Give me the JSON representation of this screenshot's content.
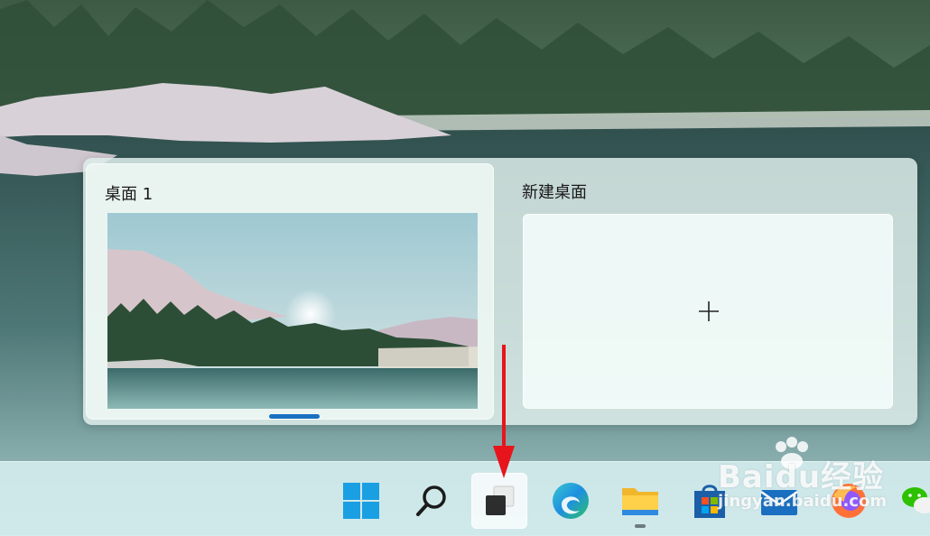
{
  "task_view": {
    "desktops": [
      {
        "label": "桌面 1",
        "active": true
      }
    ],
    "new_desktop": {
      "label": "新建桌面",
      "icon": "plus-icon"
    }
  },
  "taskbar": {
    "items": [
      {
        "name": "start",
        "icon": "windows-logo-icon"
      },
      {
        "name": "search",
        "icon": "search-icon"
      },
      {
        "name": "task-view",
        "icon": "task-view-icon",
        "hovered": true
      },
      {
        "name": "edge",
        "icon": "edge-browser-icon"
      },
      {
        "name": "file-explorer",
        "icon": "folder-icon",
        "running": true
      },
      {
        "name": "store",
        "icon": "store-icon"
      },
      {
        "name": "mail",
        "icon": "mail-icon"
      },
      {
        "name": "firefox",
        "icon": "firefox-icon"
      },
      {
        "name": "wechat",
        "icon": "wechat-icon"
      }
    ]
  },
  "watermark": {
    "main": "Baidu经验",
    "sub": "jingyan.baidu.com"
  },
  "colors": {
    "accent": "#1a6fc0",
    "arrow": "#e8141c"
  }
}
